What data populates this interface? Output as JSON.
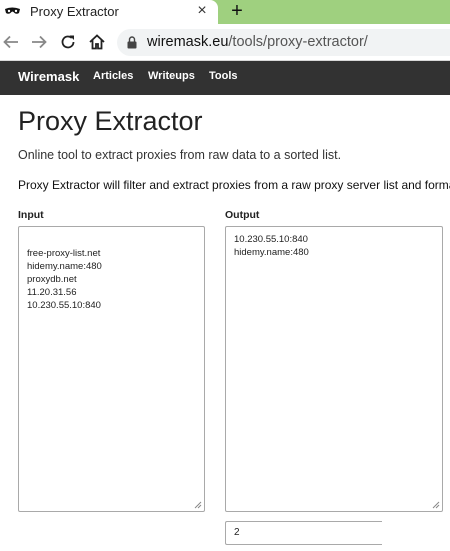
{
  "browser": {
    "tab_title": "Proxy Extractor",
    "tab_close": "×",
    "new_tab": "+",
    "url_host": "wiremask.eu",
    "url_path": "/tools/proxy-extractor/",
    "colors": {
      "tabstrip": "#9fd07f"
    }
  },
  "site": {
    "brand": "Wiremask",
    "nav": [
      "Articles",
      "Writeups",
      "Tools"
    ]
  },
  "page": {
    "title": "Proxy Extractor",
    "subtitle": "Online tool to extract proxies from raw data to a sorted list.",
    "intro": "Proxy Extractor will filter and extract proxies from a raw proxy server list and format"
  },
  "input": {
    "label": "Input",
    "lines": [
      "free-proxy-list.net",
      "hidemy.name:480",
      "proxydb.net",
      "11.20.31.56",
      "10.230.55.10:840"
    ]
  },
  "output": {
    "label": "Output",
    "lines": [
      "10.230.55.10:840",
      "hidemy.name:480"
    ],
    "count": "2"
  }
}
